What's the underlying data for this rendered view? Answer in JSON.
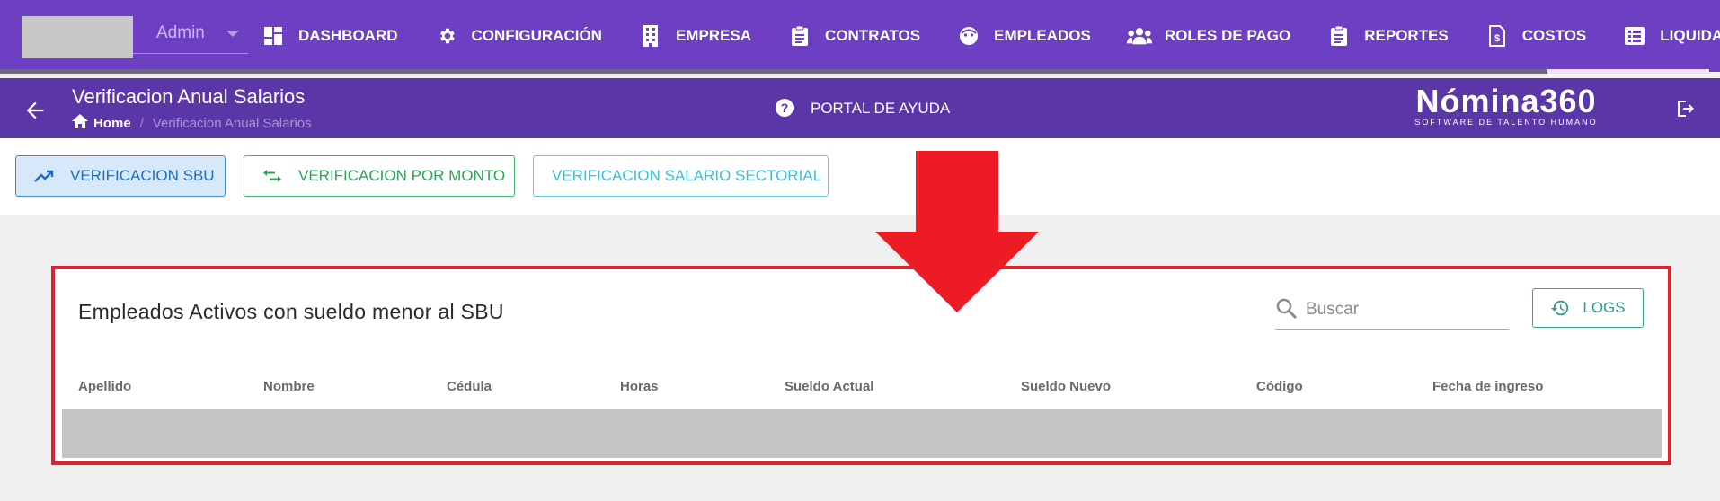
{
  "company": {
    "name": "Admin"
  },
  "nav": {
    "items": [
      {
        "label": "DASHBOARD",
        "icon": "dashboard-icon"
      },
      {
        "label": "CONFIGURACIÓN",
        "icon": "gear-icon"
      },
      {
        "label": "EMPRESA",
        "icon": "building-icon"
      },
      {
        "label": "CONTRATOS",
        "icon": "clipboard-icon"
      },
      {
        "label": "EMPLEADOS",
        "icon": "face-icon"
      },
      {
        "label": "ROLES DE PAGO",
        "icon": "people-icon"
      },
      {
        "label": "REPORTES",
        "icon": "clipboard-icon"
      },
      {
        "label": "COSTOS",
        "icon": "invoice-icon"
      },
      {
        "label": "LIQUIDACIONES",
        "icon": "list-icon"
      }
    ]
  },
  "header": {
    "title": "Verificacion Anual Salarios",
    "breadcrumb_home": "Home",
    "breadcrumb_separator": "/",
    "breadcrumb_current": "Verificacion Anual Salarios",
    "help_label": "PORTAL DE AYUDA",
    "brand_name": "Nómina360",
    "brand_tagline": "SOFTWARE DE TALENTO HUMANO"
  },
  "tabs": [
    {
      "label": "VERIFICACION SBU",
      "icon": "trending-up-icon",
      "active": true,
      "color": "#1f6fc0"
    },
    {
      "label": "VERIFICACION POR MONTO",
      "icon": "swap-icon",
      "active": false,
      "color": "#2aa656"
    },
    {
      "label": "VERIFICACION SALARIO SECTORIAL",
      "icon": "",
      "active": false,
      "color": "#3cc0d3"
    }
  ],
  "card": {
    "title": "Empleados Activos con sueldo menor al SBU",
    "search_placeholder": "Buscar",
    "logs_label": "LOGS",
    "columns": [
      "Apellido",
      "Nombre",
      "Cédula",
      "Horas",
      "Sueldo Actual",
      "Sueldo Nuevo",
      "Código",
      "Fecha de ingreso"
    ]
  },
  "colors": {
    "nav_bg": "#6c3fc3",
    "subheader_bg": "#5b36a6",
    "annotation_red": "#e0202a",
    "logs_teal": "#2a9e86"
  }
}
